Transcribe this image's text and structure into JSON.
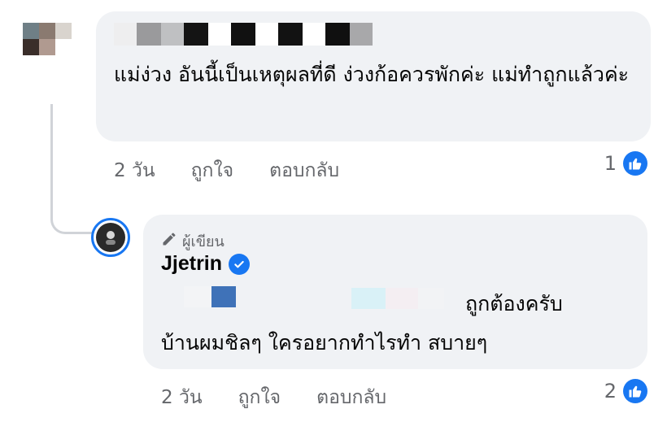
{
  "comment1": {
    "text": "แม่ง่วง อันนี้เป็นเหตุผลที่ดี ง่วงก้อควรพักค่ะ แม่ทำถูกแล้วค่ะ",
    "time": "2 วัน",
    "like_label": "ถูกใจ",
    "reply_label": "ตอบกลับ",
    "reaction_count": "1",
    "reaction_icon": "thumbs-up-icon"
  },
  "comment2": {
    "author_badge": "ผู้เขียน",
    "author_badge_icon": "pencil-icon",
    "author_name": "Jjetrin",
    "verified_icon": "verified-badge-icon",
    "text_line1": "ถูกต้องครับ",
    "text_line2": "บ้านผมชิลๆ ใครอยากทำไรทำ สบายๆ",
    "time": "2 วัน",
    "like_label": "ถูกใจ",
    "reply_label": "ตอบกลับ",
    "reaction_count": "2",
    "reaction_icon": "thumbs-up-icon"
  },
  "colors": {
    "bubble": "#f0f2f5",
    "accent": "#1877f2",
    "meta_text": "#65676b",
    "text": "#050505"
  }
}
